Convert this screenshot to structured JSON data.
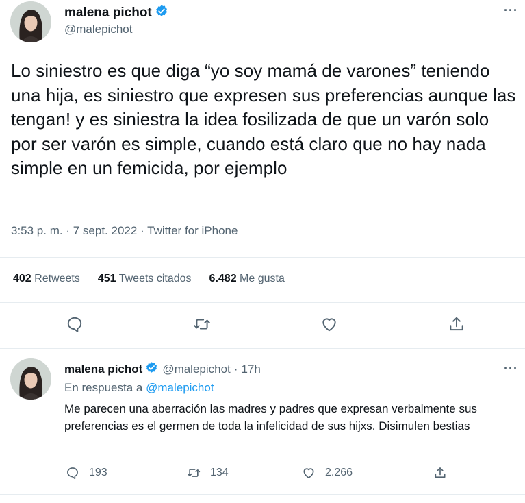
{
  "main_tweet": {
    "display_name": "malena pichot",
    "handle": "@malepichot",
    "text": "Lo siniestro es que diga “yo soy mamá de varones” teniendo una hija, es siniestro que expresen sus preferencias aunque las tengan! y es siniestra la idea fosilizada de que un varón solo por ser varón es simple, cuando está claro que no hay nada simple en un femicida, por ejemplo",
    "time": "3:53 p. m.",
    "date": "7 sept. 2022",
    "source": "Twitter for iPhone",
    "separator": "·",
    "stats": {
      "retweets_count": "402",
      "retweets_label": "Retweets",
      "quotes_count": "451",
      "quotes_label": "Tweets citados",
      "likes_count": "6.482",
      "likes_label": "Me gusta"
    },
    "more": "···"
  },
  "reply_tweet": {
    "display_name": "malena pichot",
    "handle": "@malepichot",
    "separator": "·",
    "time_ago": "17h",
    "reply_prefix": "En respuesta a",
    "reply_mention": "@malepichot",
    "text": "Me parecen una aberración las madres y padres que expresan verbalmente sus preferencias es el germen de toda la infelicidad de sus hijxs. Disimulen bestias",
    "replies": "193",
    "retweets": "134",
    "likes": "2.266",
    "more": "···"
  },
  "icons": {
    "verified": "verified-badge-icon",
    "reply": "reply-icon",
    "retweet": "retweet-icon",
    "like": "heart-icon",
    "share": "share-icon",
    "more": "more-icon"
  },
  "colors": {
    "verified_blue": "#1d9bf0",
    "text": "#0f1419",
    "secondary": "#536471",
    "divider": "#e6ecf0"
  }
}
